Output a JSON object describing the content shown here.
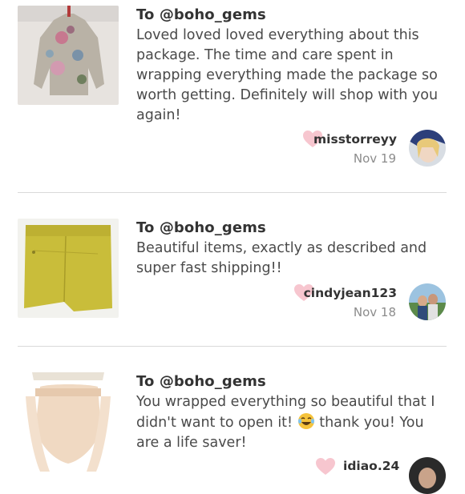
{
  "reviews": [
    {
      "to": "To @boho_gems",
      "text": "Loved loved loved everything about this package. The time and care spent in wrapping everything made the package so worth getting. Definitely will shop with you again!",
      "username": "misstorreyy",
      "date": "Nov 19"
    },
    {
      "to": "To @boho_gems",
      "text": "Beautiful items, exactly as described and super fast shipping!!",
      "username": "cindyjean123",
      "date": "Nov 18"
    },
    {
      "to": "To @boho_gems",
      "text_before_emoji": "You wrapped everything so beautiful that I didn't want to open it!",
      "text_after_emoji": "thank you! You are a life saver!",
      "username": "idiao.24",
      "date": ""
    }
  ],
  "colors": {
    "heart": "#f7c6cf",
    "divider": "#d9d9d9",
    "date": "#8c8c8c"
  },
  "icons": [
    "heart-icon",
    "laughing-emoji-icon"
  ]
}
